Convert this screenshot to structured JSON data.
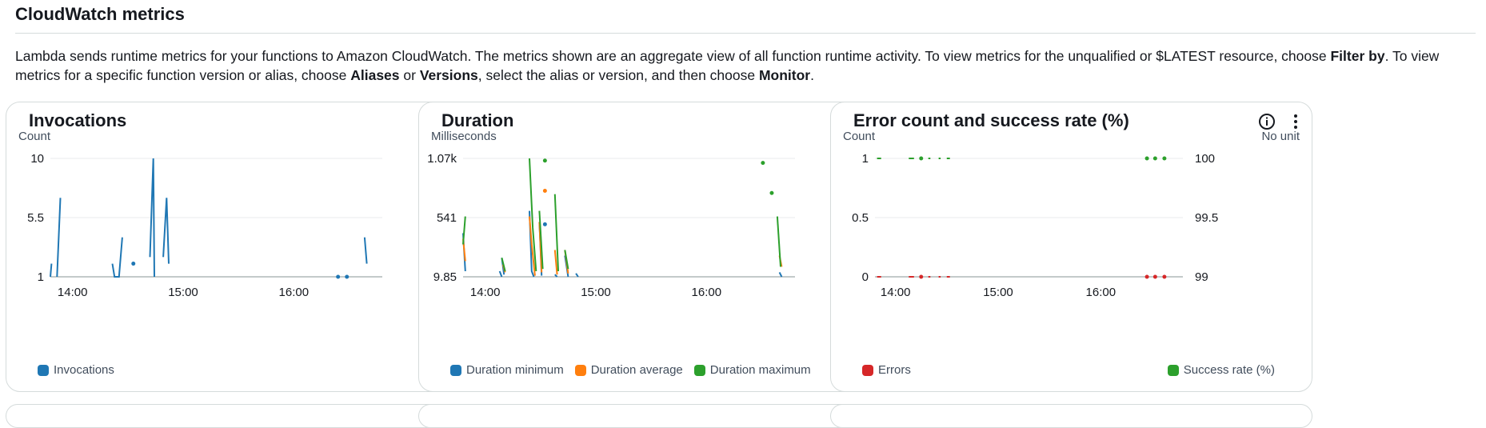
{
  "section": {
    "title": "CloudWatch metrics",
    "description_parts": [
      {
        "text": "Lambda sends runtime metrics for your functions to Amazon CloudWatch. The metrics shown are an aggregate view of all function runtime activity. To view metrics for the unqualified or $LATEST resource, choose ",
        "bold": false
      },
      {
        "text": "Filter by",
        "bold": true
      },
      {
        "text": ". To view metrics for a specific function version or alias, choose ",
        "bold": false
      },
      {
        "text": "Aliases",
        "bold": true
      },
      {
        "text": " or ",
        "bold": false
      },
      {
        "text": "Versions",
        "bold": true
      },
      {
        "text": ", select the alias or version, and then choose ",
        "bold": false
      },
      {
        "text": "Monitor",
        "bold": true
      },
      {
        "text": ".",
        "bold": false
      }
    ]
  },
  "icons": {
    "info": "info-icon",
    "actions": "kebab-menu-icon"
  },
  "colors": {
    "blue": "#1f77b4",
    "orange": "#ff7f0e",
    "green": "#2ca02c",
    "red": "#d62728",
    "grid": "#e9ebed",
    "axis": "#879596"
  },
  "chart_data": [
    {
      "type": "line",
      "title": "Invocations",
      "ylabel": "Count",
      "yticks": [
        "10",
        "5.5",
        "1"
      ],
      "ylim": [
        1,
        10
      ],
      "xticks": [
        {
          "label": "14:00",
          "t": 0.2
        },
        {
          "label": "15:00",
          "t": 1.2
        },
        {
          "label": "16:00",
          "t": 2.2
        }
      ],
      "xlim": [
        0,
        3.0
      ],
      "series": [
        {
          "name": "Invocations",
          "color": "#1f77b4",
          "segments": [
            [
              [
                0.0,
                1
              ],
              [
                0.01,
                2
              ]
            ],
            [
              [
                0.06,
                1
              ],
              [
                0.09,
                7
              ]
            ],
            [
              [
                0.56,
                2
              ],
              [
                0.58,
                1
              ],
              [
                0.62,
                1
              ],
              [
                0.65,
                4
              ]
            ],
            [
              [
                0.9,
                2.5
              ],
              [
                0.93,
                10
              ],
              [
                0.94,
                1
              ]
            ],
            [
              [
                1.02,
                2.5
              ],
              [
                1.05,
                7
              ],
              [
                1.07,
                2
              ]
            ],
            [
              [
                2.84,
                4
              ],
              [
                2.86,
                2
              ]
            ]
          ],
          "points": [
            [
              0.75,
              2
            ],
            [
              2.6,
              1
            ],
            [
              2.68,
              1
            ]
          ]
        }
      ]
    },
    {
      "type": "line",
      "title": "Duration",
      "ylabel": "Milliseconds",
      "yticks": [
        "1.07k",
        "541",
        "9.85"
      ],
      "ylim": [
        9.85,
        1070
      ],
      "xticks": [
        {
          "label": "14:00",
          "t": 0.2
        },
        {
          "label": "15:00",
          "t": 1.2
        },
        {
          "label": "16:00",
          "t": 2.2
        }
      ],
      "xlim": [
        0,
        3.0
      ],
      "series": [
        {
          "name": "Duration minimum",
          "color": "#1f77b4",
          "segments": [
            [
              [
                0.0,
                400
              ],
              [
                0.02,
                60
              ]
            ],
            [
              [
                0.35,
                180
              ],
              [
                0.37,
                30
              ]
            ],
            [
              [
                0.33,
                60
              ],
              [
                0.35,
                10
              ]
            ],
            [
              [
                0.6,
                600
              ],
              [
                0.62,
                60
              ],
              [
                0.64,
                10
              ]
            ],
            [
              [
                0.69,
                500
              ],
              [
                0.71,
                20
              ]
            ],
            [
              [
                0.83,
                30
              ],
              [
                0.85,
                10
              ]
            ],
            [
              [
                0.92,
                200
              ],
              [
                0.95,
                10
              ]
            ],
            [
              [
                1.02,
                40
              ],
              [
                1.04,
                10
              ]
            ],
            [
              [
                2.86,
                50
              ],
              [
                2.88,
                10
              ]
            ]
          ],
          "points": [
            [
              0.74,
              480
            ]
          ]
        },
        {
          "name": "Duration average",
          "color": "#ff7f0e",
          "segments": [
            [
              [
                0.0,
                350
              ],
              [
                0.02,
                150
              ]
            ],
            [
              [
                0.36,
                120
              ],
              [
                0.38,
                50
              ]
            ],
            [
              [
                0.6,
                550
              ],
              [
                0.62,
                300
              ],
              [
                0.65,
                20
              ]
            ],
            [
              [
                0.69,
                500
              ],
              [
                0.71,
                50
              ]
            ],
            [
              [
                0.83,
                250
              ],
              [
                0.85,
                30
              ]
            ],
            [
              [
                0.92,
                250
              ],
              [
                0.95,
                40
              ]
            ],
            [
              [
                2.86,
                200
              ],
              [
                2.88,
                100
              ]
            ]
          ],
          "points": [
            [
              0.74,
              780
            ]
          ]
        },
        {
          "name": "Duration maximum",
          "color": "#2ca02c",
          "segments": [
            [
              [
                0.0,
                300
              ],
              [
                0.02,
                550
              ]
            ],
            [
              [
                0.35,
                180
              ],
              [
                0.38,
                60
              ]
            ],
            [
              [
                0.6,
                1070
              ],
              [
                0.63,
                450
              ],
              [
                0.66,
                60
              ]
            ],
            [
              [
                0.69,
                600
              ],
              [
                0.72,
                80
              ]
            ],
            [
              [
                0.83,
                750
              ],
              [
                0.86,
                60
              ]
            ],
            [
              [
                0.92,
                250
              ],
              [
                0.95,
                80
              ]
            ],
            [
              [
                2.84,
                550
              ],
              [
                2.87,
                100
              ]
            ]
          ],
          "points": [
            [
              0.74,
              1050
            ],
            [
              2.71,
              1030
            ],
            [
              2.79,
              760
            ]
          ]
        }
      ]
    },
    {
      "type": "line",
      "title": "Error count and success rate (%)",
      "ylabel": "Count",
      "y2label": "No unit",
      "yticks": [
        "1",
        "0.5",
        "0"
      ],
      "y2ticks": [
        "100",
        "99.5",
        "99"
      ],
      "ylim": [
        0,
        1
      ],
      "xticks": [
        {
          "label": "14:00",
          "t": 0.2
        },
        {
          "label": "15:00",
          "t": 1.2
        },
        {
          "label": "16:00",
          "t": 2.2
        }
      ],
      "xlim": [
        0,
        3.0
      ],
      "series": [
        {
          "name": "Errors",
          "color": "#d62728",
          "axis": "left",
          "segments": [
            [
              [
                0.02,
                0
              ],
              [
                0.06,
                0
              ]
            ],
            [
              [
                0.33,
                0
              ],
              [
                0.38,
                0
              ]
            ],
            [
              [
                0.52,
                0
              ],
              [
                0.54,
                0
              ]
            ],
            [
              [
                0.62,
                0
              ],
              [
                0.64,
                0
              ]
            ],
            [
              [
                0.7,
                0
              ],
              [
                0.73,
                0
              ]
            ]
          ],
          "points": [
            [
              0.45,
              0
            ],
            [
              2.65,
              0
            ],
            [
              2.73,
              0
            ],
            [
              2.82,
              0
            ]
          ]
        },
        {
          "name": "Success rate (%)",
          "color": "#2ca02c",
          "axis": "right",
          "segments": [
            [
              [
                0.02,
                1
              ],
              [
                0.06,
                1
              ]
            ],
            [
              [
                0.33,
                1
              ],
              [
                0.38,
                1
              ]
            ],
            [
              [
                0.52,
                1
              ],
              [
                0.54,
                1
              ]
            ],
            [
              [
                0.62,
                1
              ],
              [
                0.64,
                1
              ]
            ],
            [
              [
                0.7,
                1
              ],
              [
                0.73,
                1
              ]
            ]
          ],
          "points": [
            [
              0.45,
              1
            ],
            [
              2.65,
              1
            ],
            [
              2.73,
              1
            ],
            [
              2.82,
              1
            ]
          ]
        }
      ]
    }
  ]
}
